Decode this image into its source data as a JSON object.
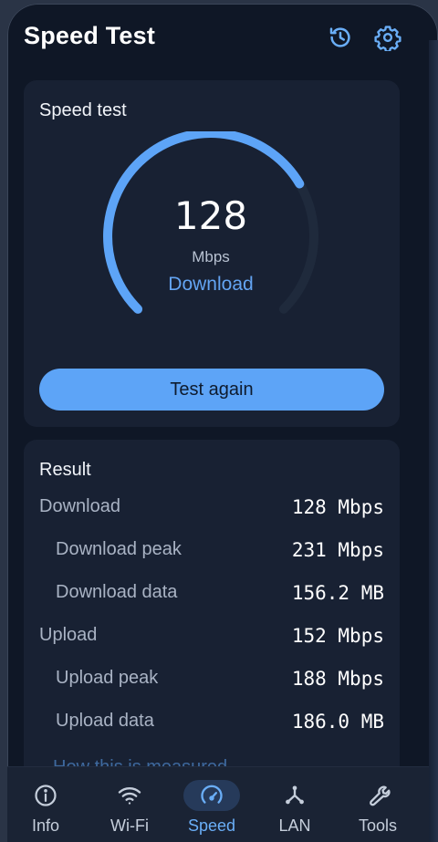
{
  "app": {
    "title": "Speed Test",
    "icons": {
      "history": "history-icon",
      "settings": "gear-icon"
    }
  },
  "speed_card": {
    "title": "Speed test",
    "value": "128",
    "unit": "Mbps",
    "mode_label": "Download",
    "gauge_level": 0.72,
    "button_label": "Test again"
  },
  "result": {
    "title": "Result",
    "rows": [
      {
        "label": "Download",
        "value": "128 Mbps"
      },
      {
        "label": "Download peak",
        "value": "231 Mbps"
      },
      {
        "label": "Download data",
        "value": "156.2 MB"
      },
      {
        "label": "Upload",
        "value": "152 Mbps"
      },
      {
        "label": "Upload peak",
        "value": "188 Mbps"
      },
      {
        "label": "Upload data",
        "value": "186.0 MB"
      }
    ],
    "link": "How this is measured"
  },
  "nav": {
    "items": [
      {
        "label": "Info",
        "icon": "info-icon"
      },
      {
        "label": "Wi-Fi",
        "icon": "wifi-icon"
      },
      {
        "label": "Speed",
        "icon": "speedometer-icon",
        "active": true
      },
      {
        "label": "LAN",
        "icon": "network-icon"
      },
      {
        "label": "Tools",
        "icon": "wrench-icon"
      }
    ]
  },
  "colors": {
    "accent": "#5da4f7",
    "background": "#0f1726",
    "card": "#182133",
    "track": "#1f2a3c"
  }
}
